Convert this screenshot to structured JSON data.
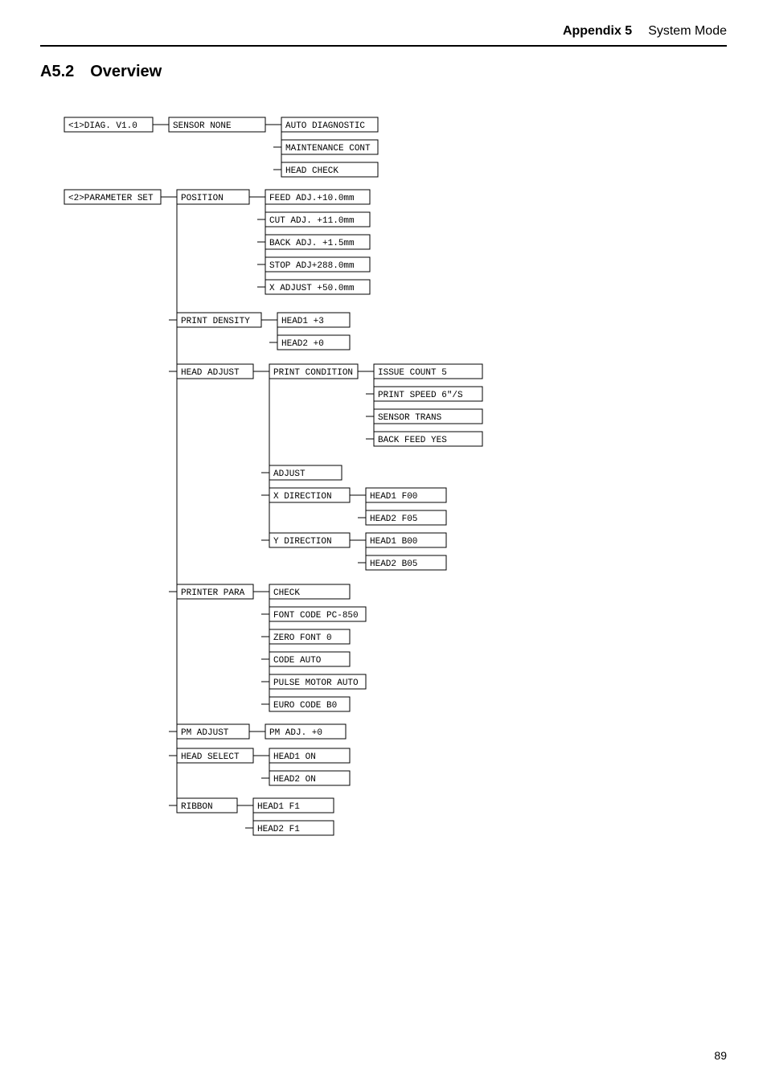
{
  "header": {
    "appendix": "Appendix 5",
    "section": "System Mode"
  },
  "title": {
    "number": "A5.2",
    "label": "Overview"
  },
  "page_number": "89",
  "diagram": {
    "nodes": {
      "diag_v1": "<1>DIAG.  V1.0",
      "sensor_none": "SENSOR      NONE",
      "auto_diagnostic": "AUTO DIAGNOSTIC",
      "maintenance_cont": "MAINTENANCE CONT",
      "head_check": "HEAD CHECK",
      "param_set": "<2>PARAMETER SET",
      "position": "POSITION",
      "feed_adj": "FEED ADJ.+10.0mm",
      "cut_adj": "CUT ADJ. +11.0mm",
      "back_adj": "BACK ADJ. +1.5mm",
      "stop_adj": "STOP ADJ+288.0mm",
      "x_adjust": "X ADJUST +50.0mm",
      "print_density": "PRINT DENSITY",
      "head1_density": "HEAD1      +3",
      "head2_density": "HEAD2      +0",
      "head_adjust": "HEAD ADJUST",
      "print_condition": "PRINT CONDITION",
      "issue_count": "ISSUE COUNT     5",
      "print_speed": "PRINT SPEED 6\"/S",
      "sensor_trans": "SENSOR    TRANS",
      "back_feed": "BACK FEED    YES",
      "adjust": "ADJUST",
      "x_direction": "X DIRECTION",
      "head1_f00": "HEAD1      F00",
      "head2_f05": "HEAD2      F05",
      "y_direction": "Y DIRECTION",
      "head1_b00": "HEAD1      B00",
      "head2_b05": "HEAD2      B05",
      "printer_para": "PRINTER PARA",
      "check": "CHECK",
      "font_code": "FONT CODE PC-850",
      "zero_font": "ZERO FONT    0",
      "code_auto": "CODE       AUTO",
      "pulse_motor": "PULSE MOTOR AUTO",
      "euro_code": "EURO CODE    B0",
      "pm_adjust": "PM ADJUST",
      "pm_adj_val": "PM ADJ.    +0",
      "head_select": "HEAD SELECT",
      "head1_on": "HEAD1      ON",
      "head2_on": "HEAD2      ON",
      "ribbon": "RIBBON",
      "head1_f1": "HEAD1      F1",
      "head2_f1": "HEAD2      F1"
    }
  }
}
